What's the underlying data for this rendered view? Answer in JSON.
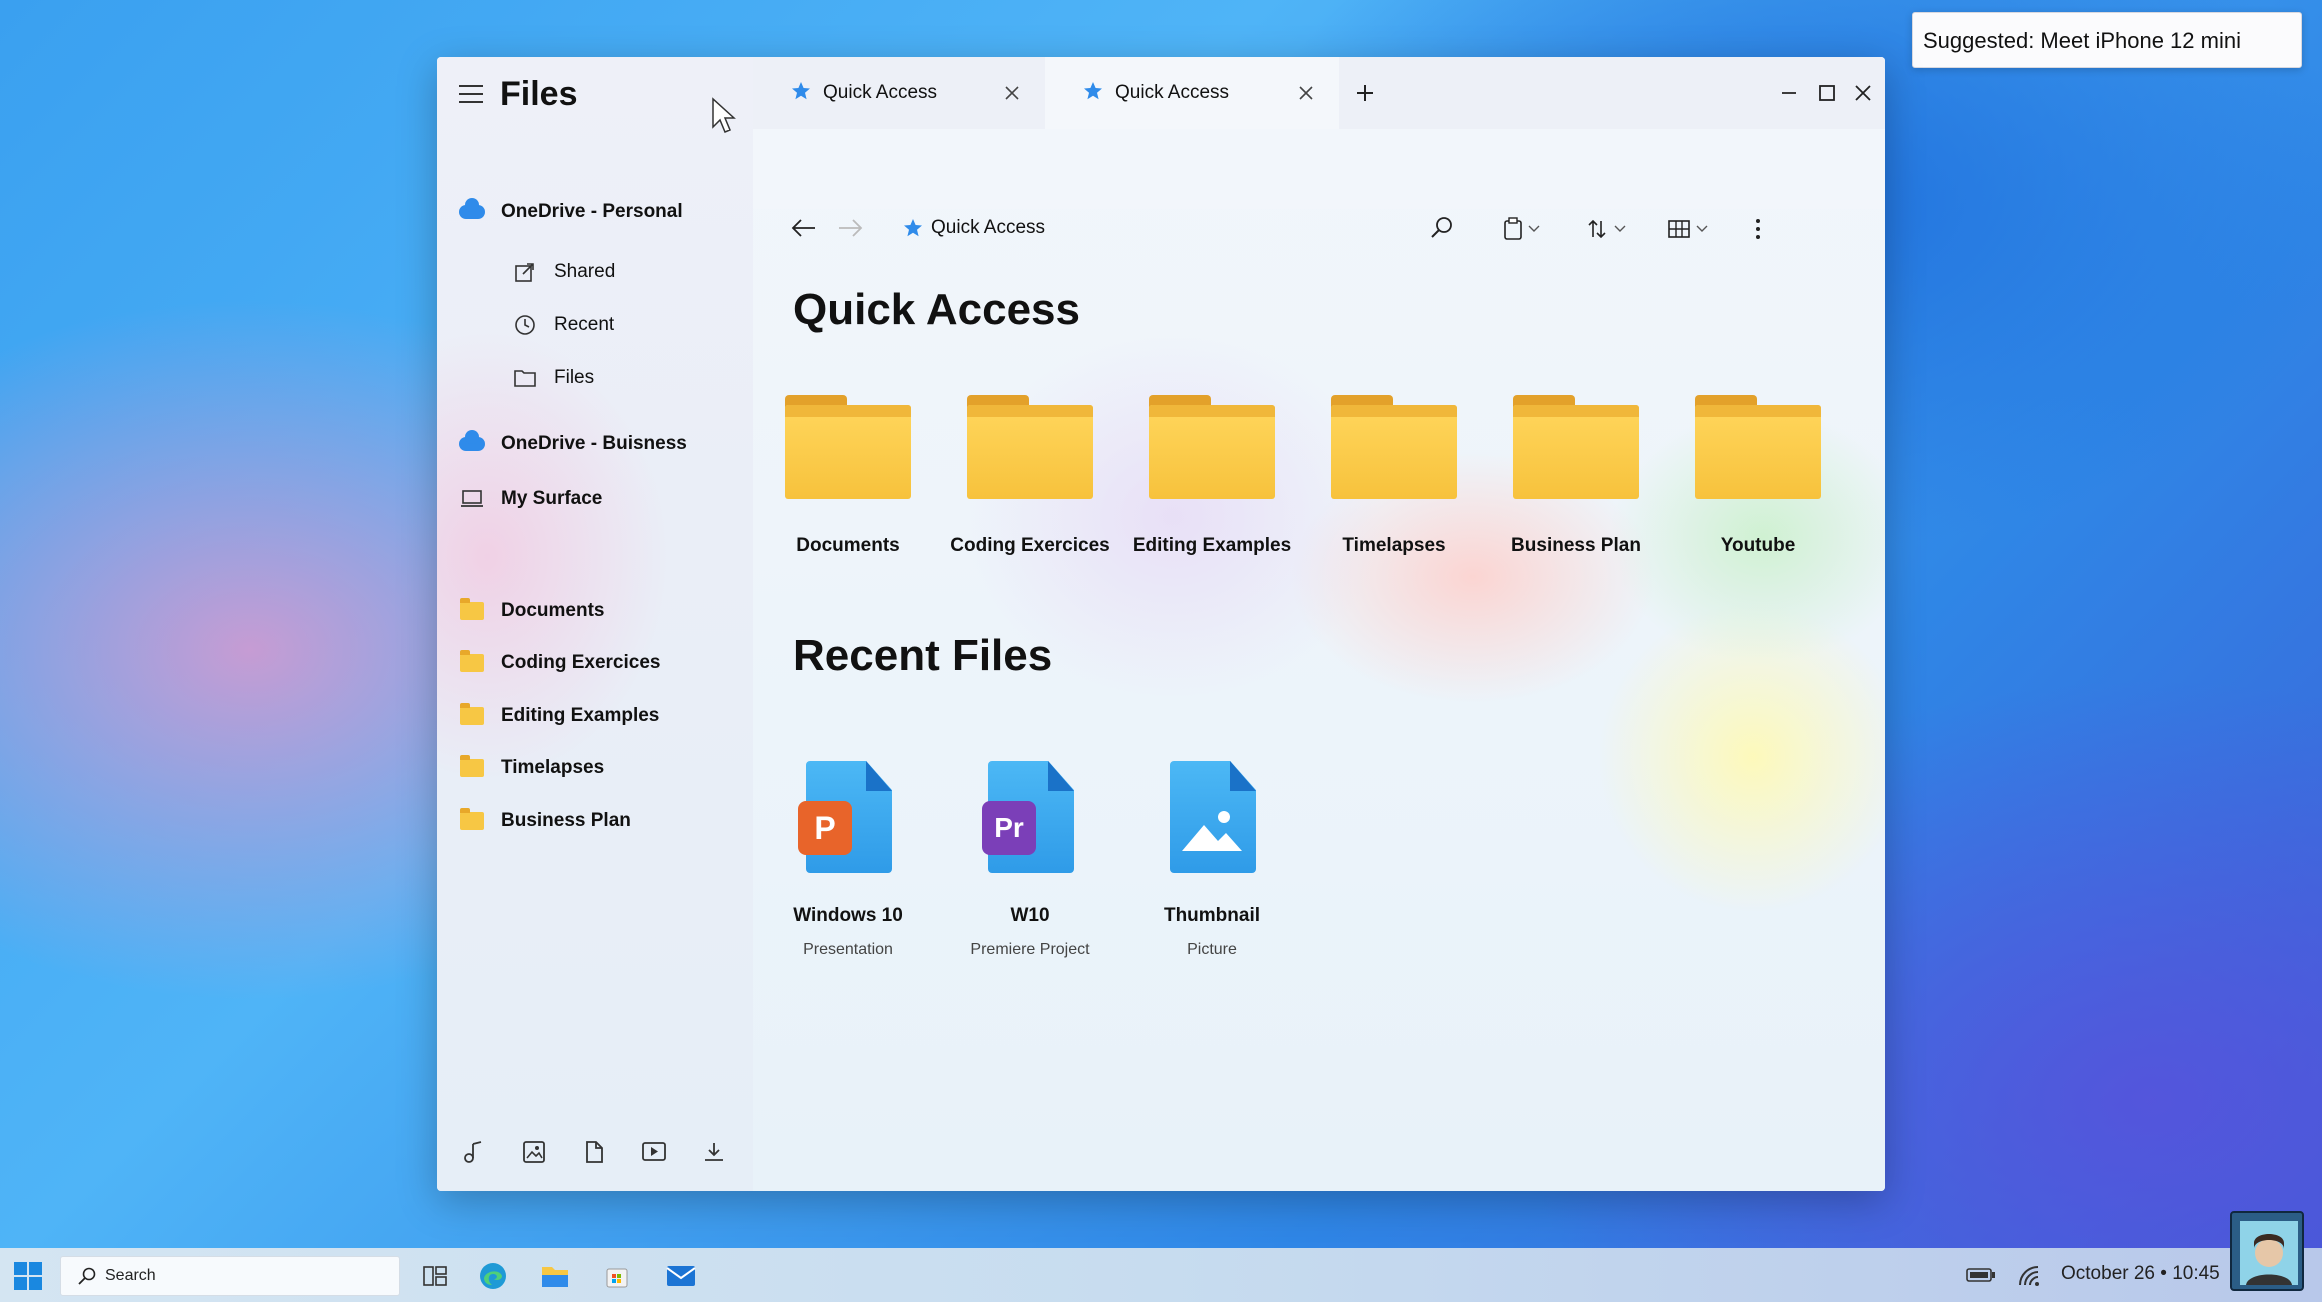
{
  "suggestion": {
    "text": "Suggested: Meet iPhone 12 mini"
  },
  "app": {
    "title": "Files"
  },
  "sidebar": {
    "accounts": [
      {
        "label": "OneDrive - Personal",
        "icon": "cloud-icon"
      },
      {
        "label": "OneDrive - Buisness",
        "icon": "cloud-icon"
      },
      {
        "label": "My Surface",
        "icon": "laptop-icon"
      }
    ],
    "sub_items": [
      {
        "label": "Shared",
        "icon": "share-icon"
      },
      {
        "label": "Recent",
        "icon": "clock-icon"
      },
      {
        "label": "Files",
        "icon": "folder-outline-icon"
      }
    ],
    "pinned": [
      {
        "label": "Documents"
      },
      {
        "label": "Coding Exercices"
      },
      {
        "label": "Editing Examples"
      },
      {
        "label": "Timelapses"
      },
      {
        "label": "Business Plan"
      }
    ],
    "bottom_icons": [
      "music-icon",
      "image-icon",
      "document-icon",
      "video-icon",
      "download-icon"
    ]
  },
  "tabs": [
    {
      "label": "Quick Access",
      "active": false
    },
    {
      "label": "Quick Access",
      "active": true
    }
  ],
  "toolbar": {
    "breadcrumb": "Quick Access"
  },
  "quick_access": {
    "title": "Quick Access",
    "folders": [
      {
        "name": "Documents"
      },
      {
        "name": "Coding Exercices"
      },
      {
        "name": "Editing Examples"
      },
      {
        "name": "Timelapses"
      },
      {
        "name": "Business Plan"
      },
      {
        "name": "Youtube"
      }
    ]
  },
  "recent_files": {
    "title": "Recent Files",
    "files": [
      {
        "name": "Windows 10",
        "type": "Presentation",
        "badge": "P",
        "badge_color": "#e8642a"
      },
      {
        "name": "W10",
        "type": "Premiere Project",
        "badge": "Pr",
        "badge_color": "#7b3fb8"
      },
      {
        "name": "Thumbnail",
        "type": "Picture",
        "badge": "",
        "badge_color": ""
      }
    ]
  },
  "taskbar": {
    "search_label": "Search",
    "clock": "October 26 • 10:45"
  },
  "colors": {
    "accent": "#2f8bea",
    "folder": "#f7c744"
  }
}
